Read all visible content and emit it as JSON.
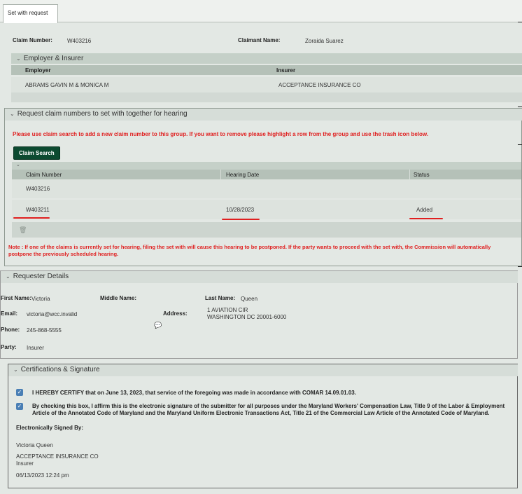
{
  "tab": {
    "label": "Set with request"
  },
  "claim": {
    "number_label": "Claim Number:",
    "number": "W403216",
    "claimant_label": "Claimant Name:",
    "claimant": "Zoraida Suarez"
  },
  "employer_insurer": {
    "title": "Employer & Insurer",
    "col_employer": "Employer",
    "col_insurer": "Insurer",
    "employer": "ABRAMS GAVIN M & MONICA M",
    "insurer": "ACCEPTANCE INSURANCE CO"
  },
  "request": {
    "title": "Request claim numbers to set with together for hearing",
    "instruction": "Please use claim search to add a new claim number to this group. If you want to remove please highlight a row from the group and use the trash icon below.",
    "search_button": "Claim Search",
    "col_claim": "Claim Number",
    "col_date": "Hearing Date",
    "col_status": "Status",
    "rows": [
      {
        "claim": "W403216",
        "date": "",
        "status": ""
      },
      {
        "claim": "W403211",
        "date": "10/28/2023",
        "status": "Added"
      }
    ],
    "note": "Note : If one of the claims is currently set for hearing, filing the set with will cause this hearing to be postponed. If the party wants to proceed with the set with, the Commission will automatically postpone the previously scheduled hearing."
  },
  "requester": {
    "title": "Requester Details",
    "first_label": "First Name:",
    "first": "Victoria",
    "middle_label": "Middle Name:",
    "last_label": "Last Name:",
    "last": "Queen",
    "email_label": "Email:",
    "email": "victoria@wcc.invalid",
    "address_label": "Address:",
    "address1": "1 AVIATION CIR",
    "address2": "WASHINGTON DC 20001-6000",
    "phone_label": "Phone:",
    "phone": "245-868-5555",
    "party_label": "Party:",
    "party": "Insurer"
  },
  "certs": {
    "title": "Certifications & Signature",
    "cert1": "I HEREBY CERTIFY that on June 13, 2023, that service of the foregoing was made in accordance with COMAR 14.09.01.03.",
    "cert2a": "By checking this box, I affirm this is the electronic signature of the submitter for all purposes under the Maryland Workers' Compensation Law, Title 9 of the Labor & Employment",
    "cert2b": "Article of the Annotated Code of Maryland and the Maryland Uniform Electronic Transactions Act, Title 21 of the Commercial Law Article of the Annotated Code of Maryland.",
    "signed_label": "Electronically Signed By:",
    "name": "Victoria Queen",
    "company": "ACCEPTANCE INSURANCE CO",
    "role": "Insurer",
    "datetime": "06/13/2023 12:24 pm"
  }
}
